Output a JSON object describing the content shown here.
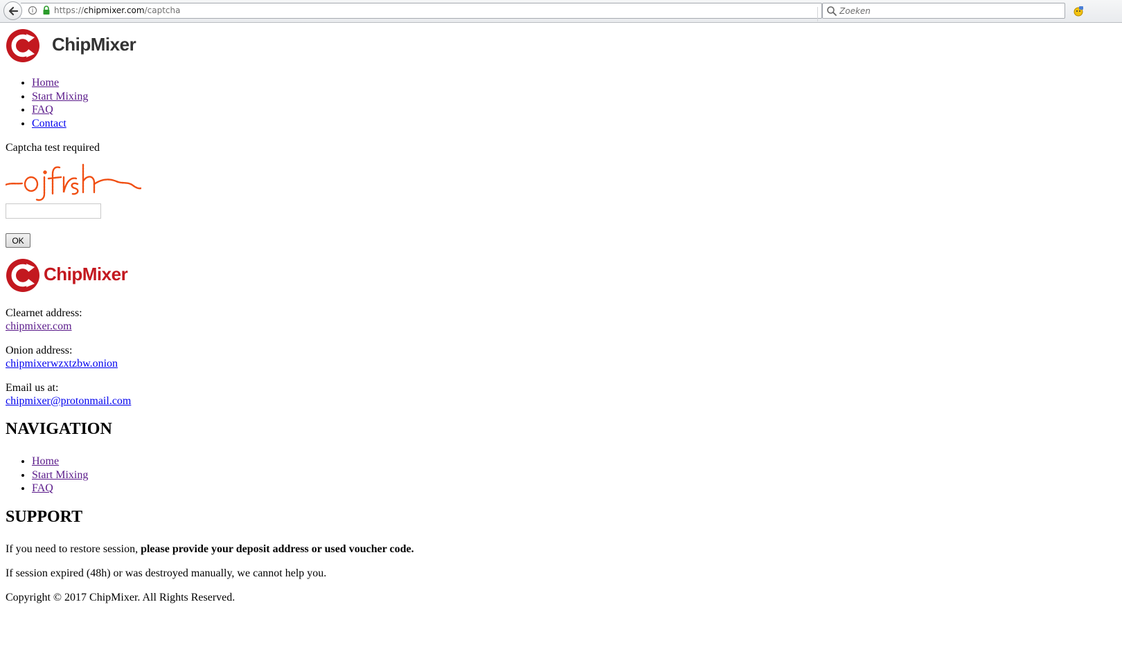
{
  "browser": {
    "url_scheme": "https://",
    "url_host": "chipmixer.com",
    "url_path": "/captcha",
    "search_placeholder": "Zoeken"
  },
  "header": {
    "logo_text": "ChipMixer",
    "nav_items": [
      "Home",
      "Start Mixing",
      "FAQ",
      "Contact"
    ]
  },
  "captcha": {
    "title": "Captcha test required",
    "input_value": "",
    "ok_label": "OK"
  },
  "footer": {
    "logo_text": "ChipMixer",
    "clearnet_label": "Clearnet address:",
    "clearnet_link": "chipmixer.com",
    "onion_label": "Onion address:",
    "onion_link": "chipmixerwzxtzbw.onion",
    "email_label": "Email us at:",
    "email_link": "chipmixer@protonmail.com",
    "navigation_heading": "NAVIGATION",
    "navigation_items": [
      "Home",
      "Start Mixing",
      "FAQ"
    ],
    "support_heading": "SUPPORT",
    "support_line1_plain": "If you need to restore session, ",
    "support_line1_bold": "please provide your deposit address or used voucher code.",
    "support_line2": "If session expired (48h) or was destroyed manually, we cannot help you.",
    "copyright": "Copyright © 2017 ChipMixer. All Rights Reserved."
  },
  "colors": {
    "brand_red": "#c3181f",
    "logo_dark": "#333333",
    "visited_link": "#5a1a8a",
    "link": "#0000ee",
    "captcha_orange": "#f04e12"
  }
}
